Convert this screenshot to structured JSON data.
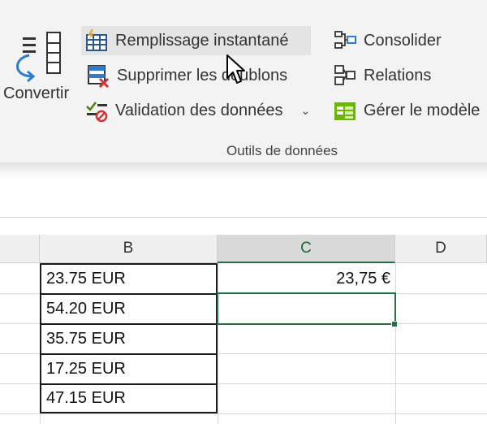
{
  "ribbon": {
    "convertir_label": "Convertir",
    "commands": {
      "flash_fill": "Remplissage instantané",
      "remove_duplicates": "Supprimer les doublons",
      "data_validation": "Validation des données",
      "consolidate": "Consolider",
      "relationships": "Relations",
      "manage_model": "Gérer le modèle"
    },
    "group_label": "Outils de données",
    "accent_color": "#217346"
  },
  "sheet": {
    "columns": [
      "B",
      "C",
      "D"
    ],
    "selected_column": "C",
    "column_b": [
      "23.75 EUR",
      "54.20 EUR",
      "35.75 EUR",
      "17.25 EUR",
      "47.15 EUR"
    ],
    "column_c": [
      "23,75 €"
    ]
  }
}
